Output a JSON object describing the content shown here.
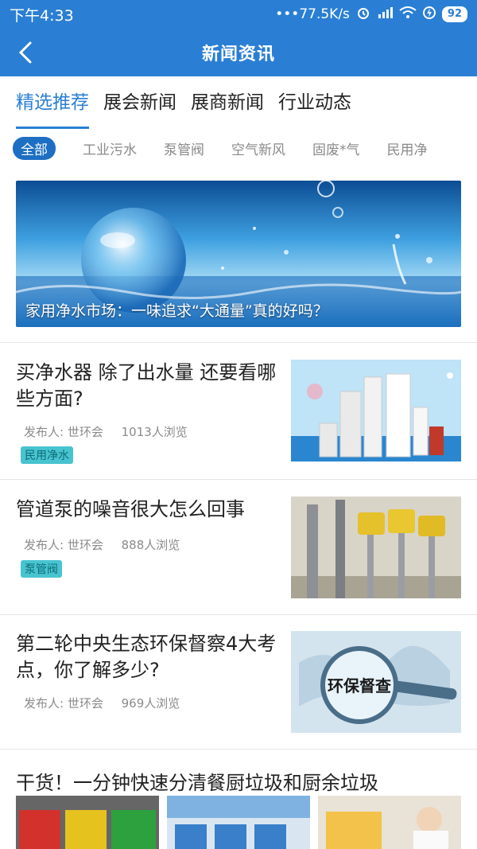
{
  "status_bar": {
    "time": "下午4:33",
    "speed": "•••77.5K/s",
    "battery": "92"
  },
  "nav": {
    "title": "新闻资讯"
  },
  "tabs": [
    {
      "label": "精选推荐",
      "active": true
    },
    {
      "label": "展会新闻"
    },
    {
      "label": "展商新闻"
    },
    {
      "label": "行业动态"
    }
  ],
  "chips": [
    {
      "label": "全部",
      "active": true
    },
    {
      "label": "工业污水"
    },
    {
      "label": "泵管阀"
    },
    {
      "label": "空气新风"
    },
    {
      "label": "固废*气"
    },
    {
      "label": "民用净"
    }
  ],
  "banner": {
    "caption": "家用净水市场：一味追求“大通量”真的好吗？"
  },
  "news": [
    {
      "title": "买净水器 除了出水量 还要看哪些方面?",
      "publisher": "发布人: 世环会",
      "views": "1013人浏览",
      "tag": "民用净水"
    },
    {
      "title": "管道泵的噪音很大怎么回事",
      "publisher": "发布人: 世环会",
      "views": "888人浏览",
      "tag": "泵管阀"
    },
    {
      "title": "第二轮中央生态环保督察4大考点，你了解多少?",
      "publisher": "发布人: 世环会",
      "views": "969人浏览",
      "thumb_text": "环保督查"
    }
  ],
  "last_news": {
    "title": "干货！一分钟快速分清餐厨垃圾和厨余垃圾"
  }
}
